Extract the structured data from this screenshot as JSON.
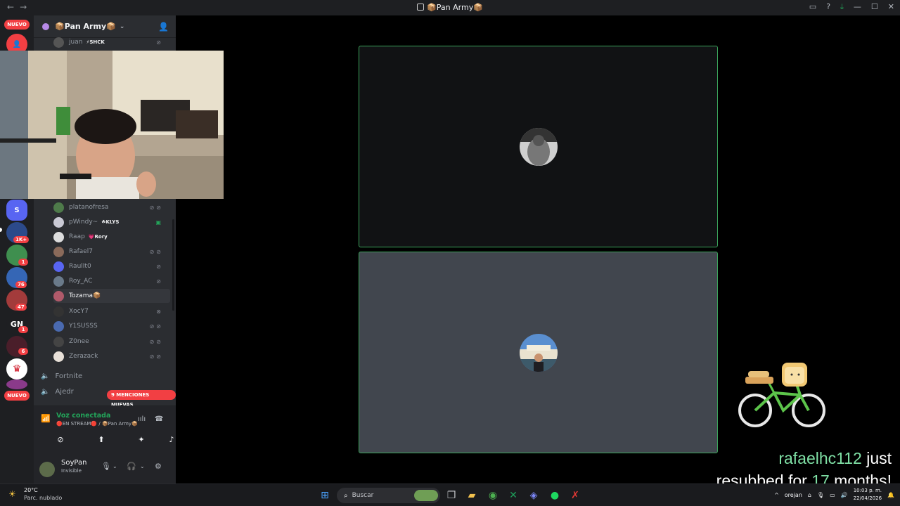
{
  "titlebar": {
    "title": "📦Pan Army📦"
  },
  "rail": {
    "top_badge": "NUEVO",
    "bottom_badge": "NUEVO",
    "gn_label": "GN",
    "counts": [
      "1K+",
      "1",
      "76",
      "47",
      "1",
      "6"
    ]
  },
  "guild": {
    "name": "📦Pan Army📦"
  },
  "members_top": [
    {
      "name": "juan",
      "tag": "⚡SHCK"
    }
  ],
  "members": [
    {
      "name": "platanofresa",
      "tag": "",
      "icons": "⊘⊘"
    },
    {
      "name": "pWindy~",
      "tag": "☘KLYS",
      "icons": "▣"
    },
    {
      "name": "Raap",
      "tag": "💗Rory",
      "icons": ""
    },
    {
      "name": "Rafael7",
      "tag": "",
      "icons": "⊘⊘"
    },
    {
      "name": "RaulIt0",
      "tag": "",
      "icons": "⊘"
    },
    {
      "name": "Roy_AC",
      "tag": "",
      "icons": "⊘"
    },
    {
      "name": "Tozama📦",
      "tag": "",
      "icons": ""
    },
    {
      "name": "XocY7",
      "tag": "",
      "icons": "⊗"
    },
    {
      "name": "Y1SUSSS",
      "tag": "",
      "icons": "⊘⊘"
    },
    {
      "name": "Z0nee",
      "tag": "",
      "icons": "⊘⊘"
    },
    {
      "name": "Zerazack",
      "tag": "",
      "icons": "⊘⊘"
    }
  ],
  "channels": [
    {
      "name": "Fortnite"
    },
    {
      "name": "Ajedr"
    }
  ],
  "mentions_badge": "9 MENCIONES NUEVAS",
  "voice": {
    "status": "Voz conectada",
    "sub": "🔴EN STREAM🔴 / 📦Pan Army📦"
  },
  "user": {
    "name": "SoyPan",
    "status": "Invisible"
  },
  "alert": {
    "user": "rafaelhc112",
    "text1": " just",
    "text2": "resubbed for ",
    "months": "17",
    "text3": " months!"
  },
  "taskbar": {
    "temp": "20°C",
    "condition": "Parc. nublado",
    "search_placeholder": "Buscar",
    "tray_label": "orejan",
    "time": "10:03 p. m.",
    "date": "22/04/2026"
  },
  "colors": {
    "speaking": "#3ba55c",
    "danger": "#f23f43",
    "sidebar": "#2b2d31"
  }
}
